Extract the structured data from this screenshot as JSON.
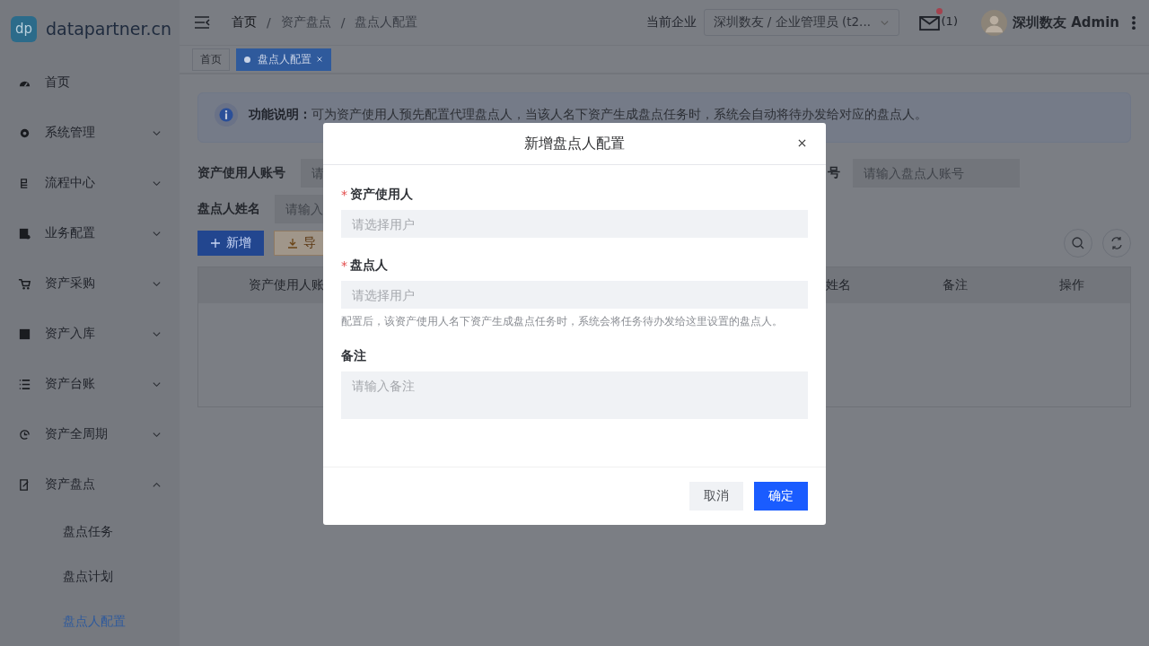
{
  "logo": {
    "badge": "dp",
    "name": "datapartner.cn"
  },
  "sidebar": {
    "items": [
      {
        "label": "首页",
        "kind": "link"
      },
      {
        "label": "系统管理",
        "kind": "group",
        "expanded": false
      },
      {
        "label": "流程中心",
        "kind": "group",
        "expanded": false
      },
      {
        "label": "业务配置",
        "kind": "group",
        "expanded": false
      },
      {
        "label": "资产采购",
        "kind": "group",
        "expanded": false
      },
      {
        "label": "资产入库",
        "kind": "group",
        "expanded": false
      },
      {
        "label": "资产台账",
        "kind": "group",
        "expanded": false
      },
      {
        "label": "资产全周期",
        "kind": "group",
        "expanded": false
      },
      {
        "label": "资产盘点",
        "kind": "group",
        "expanded": true,
        "children": [
          {
            "label": "盘点任务",
            "selected": false
          },
          {
            "label": "盘点计划",
            "selected": false
          },
          {
            "label": "盘点人配置",
            "selected": true
          }
        ]
      }
    ]
  },
  "header": {
    "breadcrumb": [
      "首页",
      "资产盘点",
      "盘点人配置"
    ],
    "separator": "/",
    "company_label": "当前企业",
    "company_select": "深圳数友 / 企业管理员 (t2...",
    "mail_count": "(1)",
    "mail_unread": true,
    "user": "深圳数友 Admin"
  },
  "tabs": [
    {
      "label": "首页",
      "selected": false
    },
    {
      "label": "盘点人配置",
      "selected": true
    }
  ],
  "notice": {
    "title": "功能说明：",
    "text": "可为资产使用人预先配置代理盘点人，当该人名下资产生成盘点任务时，系统会自动将待办发给对应的盘点人。"
  },
  "filters": [
    {
      "label": "资产使用人账号",
      "placeholder": "请"
    },
    {
      "label": "号",
      "placeholder": "请输入盘点人账号"
    },
    {
      "label": "盘点人姓名",
      "placeholder": "请输入"
    }
  ],
  "actions": [
    {
      "label": "新增",
      "kind": "primary"
    },
    {
      "label": "导",
      "kind": "warning"
    }
  ],
  "table": {
    "columns": [
      "资产使用人账",
      "姓名",
      "备注",
      "操作"
    ]
  },
  "dialog": {
    "title": "新增盘点人配置",
    "required_mark": "*",
    "fields": [
      {
        "label": "资产使用人",
        "required": true,
        "kind": "select",
        "placeholder": "请选择用户"
      },
      {
        "label": "盘点人",
        "required": true,
        "kind": "select",
        "placeholder": "请选择用户",
        "hint": "配置后，该资产使用人名下资产生成盘点任务时，系统会将任务待办发给这里设置的盘点人。"
      },
      {
        "label": "备注",
        "required": false,
        "kind": "textarea",
        "placeholder": "请输入备注"
      }
    ],
    "buttons": [
      {
        "label": "取消",
        "kind": "default"
      },
      {
        "label": "确定",
        "kind": "primary"
      }
    ]
  }
}
